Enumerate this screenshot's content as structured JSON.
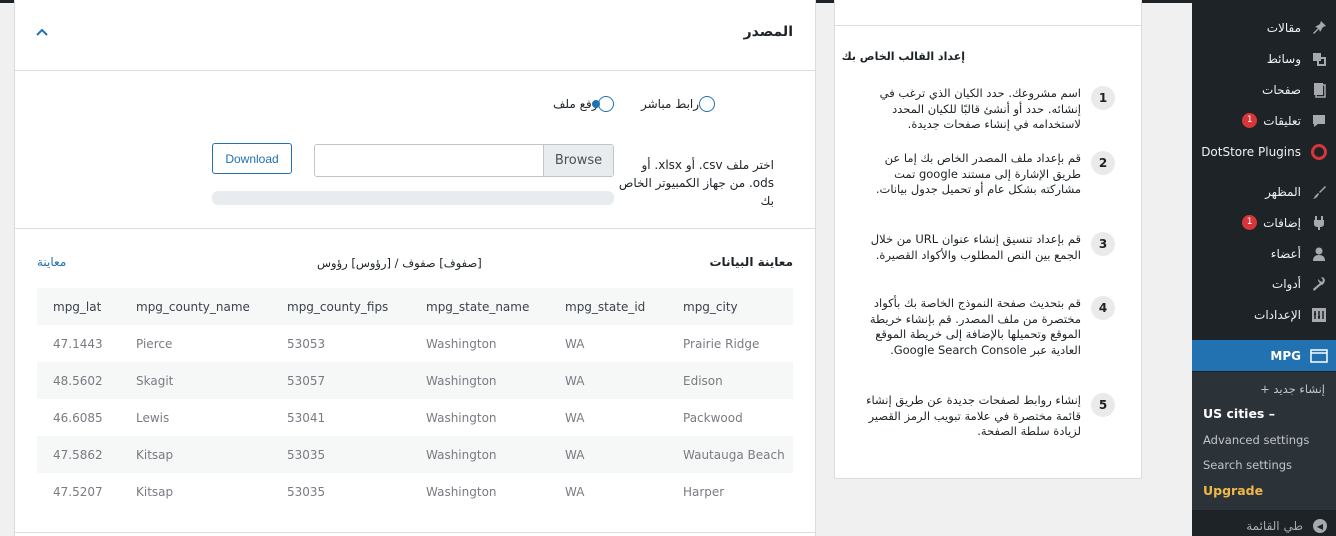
{
  "sidebar": {
    "items": [
      {
        "label": "مقالات",
        "icon": "pin-icon"
      },
      {
        "label": "وسائط",
        "icon": "media-icon"
      },
      {
        "label": "صفحات",
        "icon": "pages-icon"
      },
      {
        "label": "تعليقات",
        "icon": "comment-icon",
        "badge": "1"
      },
      {
        "label": "DotStore Plugins",
        "icon": "dotstore-icon"
      },
      {
        "label": "المظهر",
        "icon": "brush-icon"
      },
      {
        "label": "إضافات",
        "icon": "plugin-icon",
        "badge": "1"
      },
      {
        "label": "أعضاء",
        "icon": "user-icon"
      },
      {
        "label": "أدوات",
        "icon": "wrench-icon"
      },
      {
        "label": "الإعدادات",
        "icon": "settings-icon"
      },
      {
        "label": "MPG",
        "icon": "mpg-icon"
      }
    ],
    "submenu": {
      "add_new": "إنشاء جديد +",
      "current": "US cities –",
      "advanced": "Advanced settings",
      "search": "Search settings",
      "upgrade": "Upgrade"
    },
    "collapse_label": "طي القائمة"
  },
  "info": {
    "title": "إعداد القالب الخاص بك",
    "steps": [
      {
        "num": "1",
        "text": "اسم مشروعك. حدد الكيان الذي ترغب في إنشائه. حدد أو أنشئ قالبًا للكيان المحدد لاستخدامه في إنشاء صفحات جديدة."
      },
      {
        "num": "2",
        "text": "قم بإعداد ملف المصدر الخاص بك إما عن طريق الإشارة إلى مستند google تمت مشاركته بشكل عام أو تحميل جدول بيانات."
      },
      {
        "num": "3",
        "text": "قم بإعداد تنسيق إنشاء عنوان URL من خلال الجمع بين النص المطلوب والأكواد القصيرة."
      },
      {
        "num": "4",
        "text": "قم بتحديث صفحة النموذج الخاصة بك بأكواد مختصرة من ملف المصدر. قم بإنشاء خريطة الموقع وتحميلها بالإضافة إلى خريطة الموقع العادية عبر Google Search Console."
      },
      {
        "num": "5",
        "text": "إنشاء روابط لصفحات جديدة عن طريق إنشاء قائمة مختصرة في علامة تبويب الرمز القصير لزيادة سلطة الصفحة."
      }
    ]
  },
  "source": {
    "title": "المصدر",
    "radio_direct": "رابط مباشر",
    "radio_upload": "رفع ملف",
    "selected": "upload",
    "file_help": "اختر ملف csv. أو xlsx. أو ods. من جهاز الكمبيوتر الخاص بك",
    "browse_label": "Browse",
    "download_label": "Download",
    "upload_progress": 0
  },
  "preview": {
    "title": "معاينة البيانات",
    "options": "[صفوف] صفوف / [رؤوس] رؤوس",
    "link": "معاينة",
    "columns": [
      "mpg_lat",
      "mpg_county_name",
      "mpg_county_fips",
      "mpg_state_name",
      "mpg_state_id",
      "mpg_city"
    ],
    "rows": [
      [
        "47.1443",
        "Pierce",
        "53053",
        "Washington",
        "WA",
        "Prairie Ridge"
      ],
      [
        "48.5602",
        "Skagit",
        "53057",
        "Washington",
        "WA",
        "Edison"
      ],
      [
        "46.6085",
        "Lewis",
        "53041",
        "Washington",
        "WA",
        "Packwood"
      ],
      [
        "47.5862",
        "Kitsap",
        "53035",
        "Washington",
        "WA",
        "Wautauga Beach"
      ],
      [
        "47.5207",
        "Kitsap",
        "53035",
        "Washington",
        "WA",
        "Harper"
      ]
    ]
  },
  "colors": {
    "accent": "#2271b1",
    "sidebar_bg": "#1d2327",
    "badge": "#d63638",
    "upgrade": "#f0b849"
  }
}
